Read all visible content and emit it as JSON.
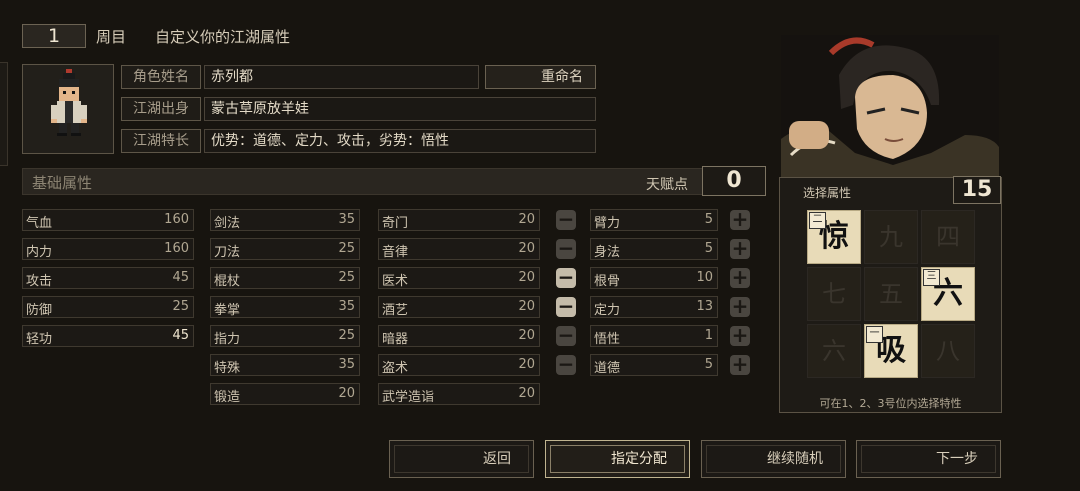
{
  "header": {
    "cycle_number": "1",
    "cycle_label": "周目",
    "subtitle": "自定义你的江湖属性"
  },
  "profile": {
    "name_label": "角色姓名",
    "name_value": "赤列都",
    "rename_label": "重命名",
    "origin_label": "江湖出身",
    "origin_value": "蒙古草原放羊娃",
    "trait_label": "江湖特长",
    "trait_value": "优势：道德、定力、攻击，劣势：悟性"
  },
  "base": {
    "title": "基础属性",
    "talent_label": "天赋点",
    "talent_points": "0"
  },
  "col1": [
    {
      "name": "气血",
      "value": "160"
    },
    {
      "name": "内力",
      "value": "160"
    },
    {
      "name": "攻击",
      "value": "45"
    },
    {
      "name": "防御",
      "value": "25"
    },
    {
      "name": "轻功",
      "value": "45"
    }
  ],
  "col2": [
    {
      "name": "剑法",
      "value": "35"
    },
    {
      "name": "刀法",
      "value": "25"
    },
    {
      "name": "棍杖",
      "value": "25"
    },
    {
      "name": "拳掌",
      "value": "35"
    },
    {
      "name": "指力",
      "value": "25"
    },
    {
      "name": "特殊",
      "value": "35"
    },
    {
      "name": "锻造",
      "value": "20"
    }
  ],
  "col3": [
    {
      "name": "奇门",
      "value": "20"
    },
    {
      "name": "音律",
      "value": "20"
    },
    {
      "name": "医术",
      "value": "20"
    },
    {
      "name": "酒艺",
      "value": "20"
    },
    {
      "name": "暗器",
      "value": "20"
    },
    {
      "name": "盗术",
      "value": "20"
    },
    {
      "name": "武学造诣",
      "value": "20"
    }
  ],
  "col4": [
    {
      "name": "臂力",
      "value": "5"
    },
    {
      "name": "身法",
      "value": "5"
    },
    {
      "name": "根骨",
      "value": "10"
    },
    {
      "name": "定力",
      "value": "13"
    },
    {
      "name": "悟性",
      "value": "1"
    },
    {
      "name": "道德",
      "value": "5"
    }
  ],
  "selector": {
    "title": "选择属性",
    "count": "15",
    "grid": [
      {
        "char": "惊",
        "tag": "二",
        "selected": true
      },
      {
        "char": "九",
        "tag": "",
        "selected": false
      },
      {
        "char": "四",
        "tag": "",
        "selected": false
      },
      {
        "char": "七",
        "tag": "",
        "selected": false
      },
      {
        "char": "五",
        "tag": "",
        "selected": false
      },
      {
        "char": "六",
        "tag": "三",
        "selected": true
      },
      {
        "char": "六",
        "tag": "",
        "selected": false
      },
      {
        "char": "吸",
        "tag": "一",
        "selected": true
      },
      {
        "char": "八",
        "tag": "",
        "selected": false
      }
    ],
    "hint": "可在1、2、3号位内选择特性"
  },
  "buttons": {
    "back": "返回",
    "assign": "指定分配",
    "reroll": "继续随机",
    "next": "下一步"
  },
  "colors": {
    "background": "#17140f",
    "text": "#d9cfbd",
    "cell_selected": "#e8dbb8"
  }
}
